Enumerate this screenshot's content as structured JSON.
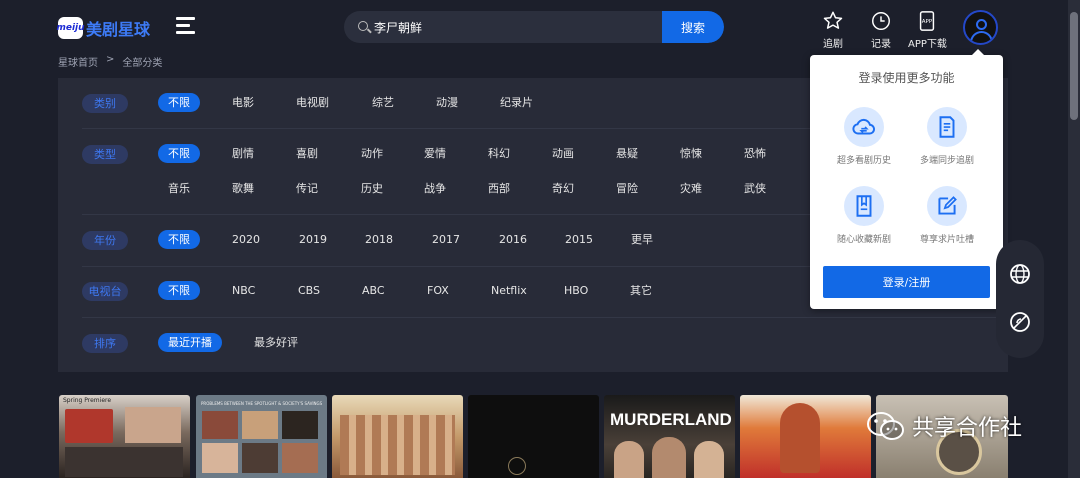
{
  "header": {
    "logo_badge": "meiju",
    "logo_text": "美剧星球",
    "search_value": "李尸朝鲜",
    "search_button": "搜索",
    "tools": [
      {
        "label": "追剧",
        "icon": "star-icon"
      },
      {
        "label": "记录",
        "icon": "clock-icon"
      },
      {
        "label": "APP下载",
        "icon": "app-download-icon"
      }
    ]
  },
  "breadcrumb": {
    "home": "星球首页",
    "sep": ">",
    "current": "全部分类"
  },
  "filters": {
    "category": {
      "label": "类别",
      "options": [
        "不限",
        "电影",
        "电视剧",
        "综艺",
        "动漫",
        "纪录片"
      ]
    },
    "genre": {
      "label": "类型",
      "row1": [
        "不限",
        "剧情",
        "喜剧",
        "动作",
        "爱情",
        "科幻",
        "动画",
        "悬疑",
        "惊悚",
        "恐怖"
      ],
      "row2": [
        "音乐",
        "歌舞",
        "传记",
        "历史",
        "战争",
        "西部",
        "奇幻",
        "冒险",
        "灾难",
        "武侠"
      ]
    },
    "year": {
      "label": "年份",
      "options": [
        "不限",
        "2020",
        "2019",
        "2018",
        "2017",
        "2016",
        "2015",
        "更早"
      ]
    },
    "network": {
      "label": "电视台",
      "options": [
        "不限",
        "NBC",
        "CBS",
        "ABC",
        "FOX",
        "Netflix",
        "HBO",
        "其它"
      ]
    },
    "sort": {
      "label": "排序",
      "options": [
        "最近开播",
        "最多好评"
      ]
    }
  },
  "login_popup": {
    "title": "登录使用更多功能",
    "features": [
      {
        "label": "超多看剧历史",
        "icon": "cloud-sync-icon"
      },
      {
        "label": "多端同步追剧",
        "icon": "document-icon"
      },
      {
        "label": "随心收藏新剧",
        "icon": "bookmark-icon"
      },
      {
        "label": "尊享求片吐槽",
        "icon": "edit-icon"
      }
    ],
    "button": "登录/注册"
  },
  "posters": {
    "poster1_title": "Spring Premiere",
    "poster2_caption": "PROBLEMS BETWEEN THE SPOTLIGHT & SOCIETY'S SAVINGS",
    "poster5_title": "MURDERLAND"
  },
  "watermark": "共享合作社",
  "colors": {
    "accent": "#1269e6",
    "background": "#1c1f2b",
    "panel": "#282b38"
  }
}
